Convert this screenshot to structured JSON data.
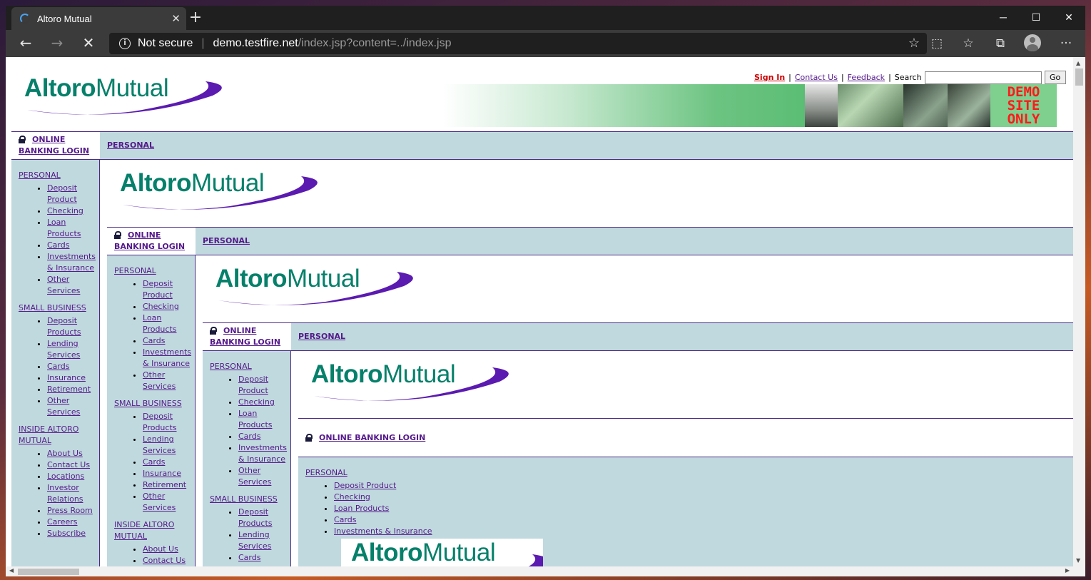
{
  "browser": {
    "tab_title": "Altoro Mutual",
    "tab_close": "✕",
    "new_tab": "+",
    "minimize": "─",
    "maximize": "☐",
    "close": "✕",
    "security_label": "Not secure",
    "url_host": "demo.testfire.net",
    "url_path": "/index.jsp?content=../index.jsp"
  },
  "header": {
    "sign_in": "Sign In",
    "contact_us": "Contact Us",
    "feedback": "Feedback",
    "search_label": "Search",
    "search_value": "",
    "go": "Go",
    "demo_line1": "DEMO",
    "demo_line2": "SITE",
    "demo_line3": "ONLY"
  },
  "logo": {
    "bold": "Altoro",
    "regular": "Mutual"
  },
  "login": {
    "line1": "ONLINE",
    "line2": "BANKING LOGIN",
    "single": "ONLINE BANKING LOGIN"
  },
  "tab_personal": "PERSONAL",
  "sidebar": {
    "personal": "PERSONAL",
    "personal_items": [
      "Deposit",
      "Product",
      "Checking",
      "Loan",
      "Products",
      "Cards",
      "Investments",
      "& Insurance",
      "Other",
      "Services"
    ],
    "small_business": "SMALL BUSINESS",
    "small_business_items": [
      "Deposit",
      "Products",
      "Lending",
      "Services",
      "Cards",
      "Insurance",
      "Retirement",
      "Other",
      "Services"
    ],
    "inside_1": "INSIDE ALTORO",
    "inside_2": "MUTUAL",
    "inside_items": [
      "About Us",
      "Contact Us",
      "Locations",
      "Investor",
      "Relations",
      "Press Room",
      "Careers",
      "Subscribe"
    ]
  },
  "bottom_panel": {
    "personal": "PERSONAL",
    "items": [
      "Deposit Product",
      "Checking",
      "Loan Products",
      "Cards",
      "Investments & Insurance"
    ]
  }
}
